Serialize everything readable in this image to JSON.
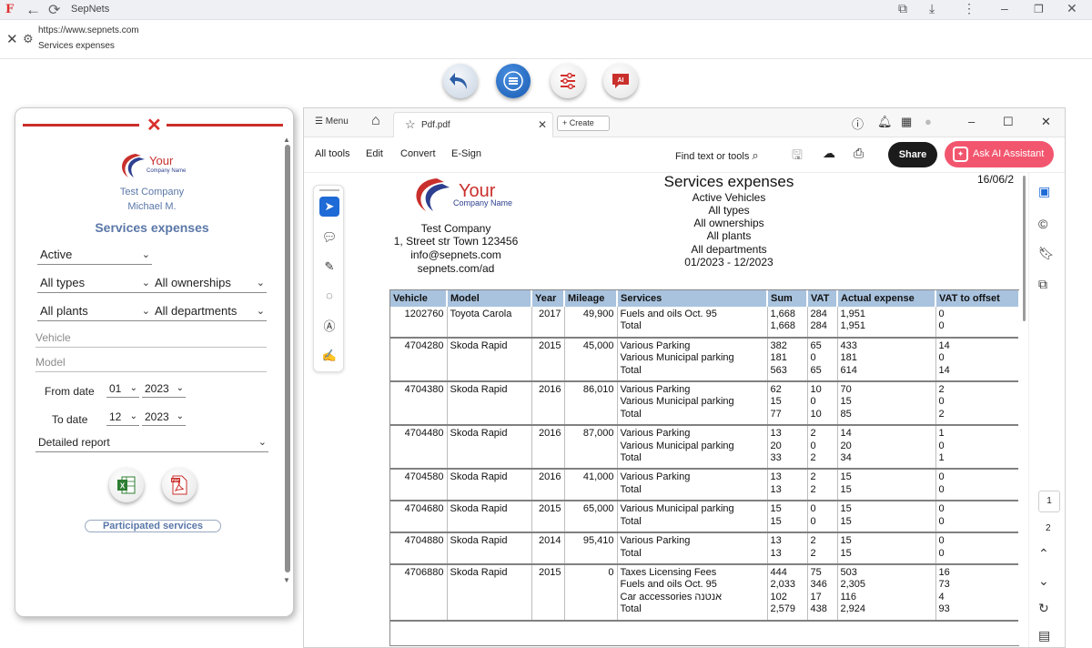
{
  "browser": {
    "title": "SepNets",
    "url": "https://www.sepnets.com",
    "page_subtitle": "Services expenses"
  },
  "left_panel": {
    "logo_text_main": "Your",
    "logo_text_sub": "Company Name",
    "company": "Test Company",
    "user": "Michael M.",
    "heading": "Services expenses",
    "status_select": "Active",
    "type_select": "All types",
    "ownership_select": "All ownerships",
    "plant_select": "All plants",
    "department_select": "All departments",
    "vehicle_placeholder": "Vehicle",
    "model_placeholder": "Model",
    "from_date_label": "From date",
    "from_month": "01",
    "from_year": "2023",
    "to_date_label": "To date",
    "to_month": "12",
    "to_year": "2023",
    "report_type": "Detailed report",
    "participated_button": "Participated services",
    "excel_icon": "excel-icon",
    "pdf_icon": "pdf-icon"
  },
  "pdf_viewer": {
    "menu_label": "Menu",
    "tab_name": "Pdf.pdf",
    "create_label": "Create",
    "toolbar": {
      "all_tools": "All tools",
      "edit": "Edit",
      "convert": "Convert",
      "esign": "E-Sign",
      "find": "Find text or tools",
      "share": "Share",
      "ask_ai": "Ask AI Assistant"
    },
    "page_current": "1",
    "page_next": "2"
  },
  "report": {
    "title": "Services expenses",
    "subtitle_lines": [
      "Active Vehicles",
      "All types",
      "All ownerships",
      "All plants",
      "All departments",
      "01/2023 - 12/2023"
    ],
    "date": "16/06/2",
    "logo_text_main": "Your",
    "logo_text_sub": "Company Name",
    "company_lines": [
      "Test Company",
      "1, Street str Town 123456",
      "info@sepnets.com",
      "sepnets.com/ad"
    ],
    "columns": [
      "Vehicle",
      "Model",
      "Year",
      "Mileage",
      "Services",
      "Sum",
      "VAT",
      "Actual expense",
      "VAT to offset"
    ],
    "rows": [
      {
        "vehicle": "1202760",
        "model": "Toyota Carola",
        "year": "2017",
        "mileage": "49,900",
        "services": [
          "Fuels and oils Oct. 95",
          "Total"
        ],
        "sum": [
          "1,668",
          "1,668"
        ],
        "vat": [
          "284",
          "284"
        ],
        "actual": [
          "1,951",
          "1,951"
        ],
        "offset": [
          "0",
          "0"
        ]
      },
      {
        "vehicle": "4704280",
        "model": "Skoda Rapid",
        "year": "2015",
        "mileage": "45,000",
        "services": [
          "Various Parking",
          "Various Municipal parking",
          "Total"
        ],
        "sum": [
          "382",
          "181",
          "563"
        ],
        "vat": [
          "65",
          "0",
          "65"
        ],
        "actual": [
          "433",
          "181",
          "614"
        ],
        "offset": [
          "14",
          "0",
          "14"
        ]
      },
      {
        "vehicle": "4704380",
        "model": "Skoda Rapid",
        "year": "2016",
        "mileage": "86,010",
        "services": [
          "Various Parking",
          "Various Municipal parking",
          "Total"
        ],
        "sum": [
          "62",
          "15",
          "77"
        ],
        "vat": [
          "10",
          "0",
          "10"
        ],
        "actual": [
          "70",
          "15",
          "85"
        ],
        "offset": [
          "2",
          "0",
          "2"
        ]
      },
      {
        "vehicle": "4704480",
        "model": "Skoda Rapid",
        "year": "2016",
        "mileage": "87,000",
        "services": [
          "Various Parking",
          "Various Municipal parking",
          "Total"
        ],
        "sum": [
          "13",
          "20",
          "33"
        ],
        "vat": [
          "2",
          "0",
          "2"
        ],
        "actual": [
          "14",
          "20",
          "34"
        ],
        "offset": [
          "1",
          "0",
          "1"
        ]
      },
      {
        "vehicle": "4704580",
        "model": "Skoda Rapid",
        "year": "2016",
        "mileage": "41,000",
        "services": [
          "Various Parking",
          "Total"
        ],
        "sum": [
          "13",
          "13"
        ],
        "vat": [
          "2",
          "2"
        ],
        "actual": [
          "15",
          "15"
        ],
        "offset": [
          "0",
          "0"
        ]
      },
      {
        "vehicle": "4704680",
        "model": "Skoda Rapid",
        "year": "2015",
        "mileage": "65,000",
        "services": [
          "Various Municipal parking",
          "Total"
        ],
        "sum": [
          "15",
          "15"
        ],
        "vat": [
          "0",
          "0"
        ],
        "actual": [
          "15",
          "15"
        ],
        "offset": [
          "0",
          "0"
        ]
      },
      {
        "vehicle": "4704880",
        "model": "Skoda Rapid",
        "year": "2014",
        "mileage": "95,410",
        "services": [
          "Various Parking",
          "Total"
        ],
        "sum": [
          "13",
          "13"
        ],
        "vat": [
          "2",
          "2"
        ],
        "actual": [
          "15",
          "15"
        ],
        "offset": [
          "0",
          "0"
        ]
      },
      {
        "vehicle": "4706880",
        "model": "Skoda Rapid",
        "year": "2015",
        "mileage": "0",
        "services": [
          "Taxes Licensing Fees",
          "Fuels and oils Oct. 95",
          "Car accessories אנטנה",
          "Total"
        ],
        "sum": [
          "444",
          "2,033",
          "102",
          "2,579"
        ],
        "vat": [
          "75",
          "346",
          "17",
          "438"
        ],
        "actual": [
          "503",
          "2,305",
          "116",
          "2,924"
        ],
        "offset": [
          "16",
          "73",
          "4",
          "93"
        ]
      }
    ]
  }
}
